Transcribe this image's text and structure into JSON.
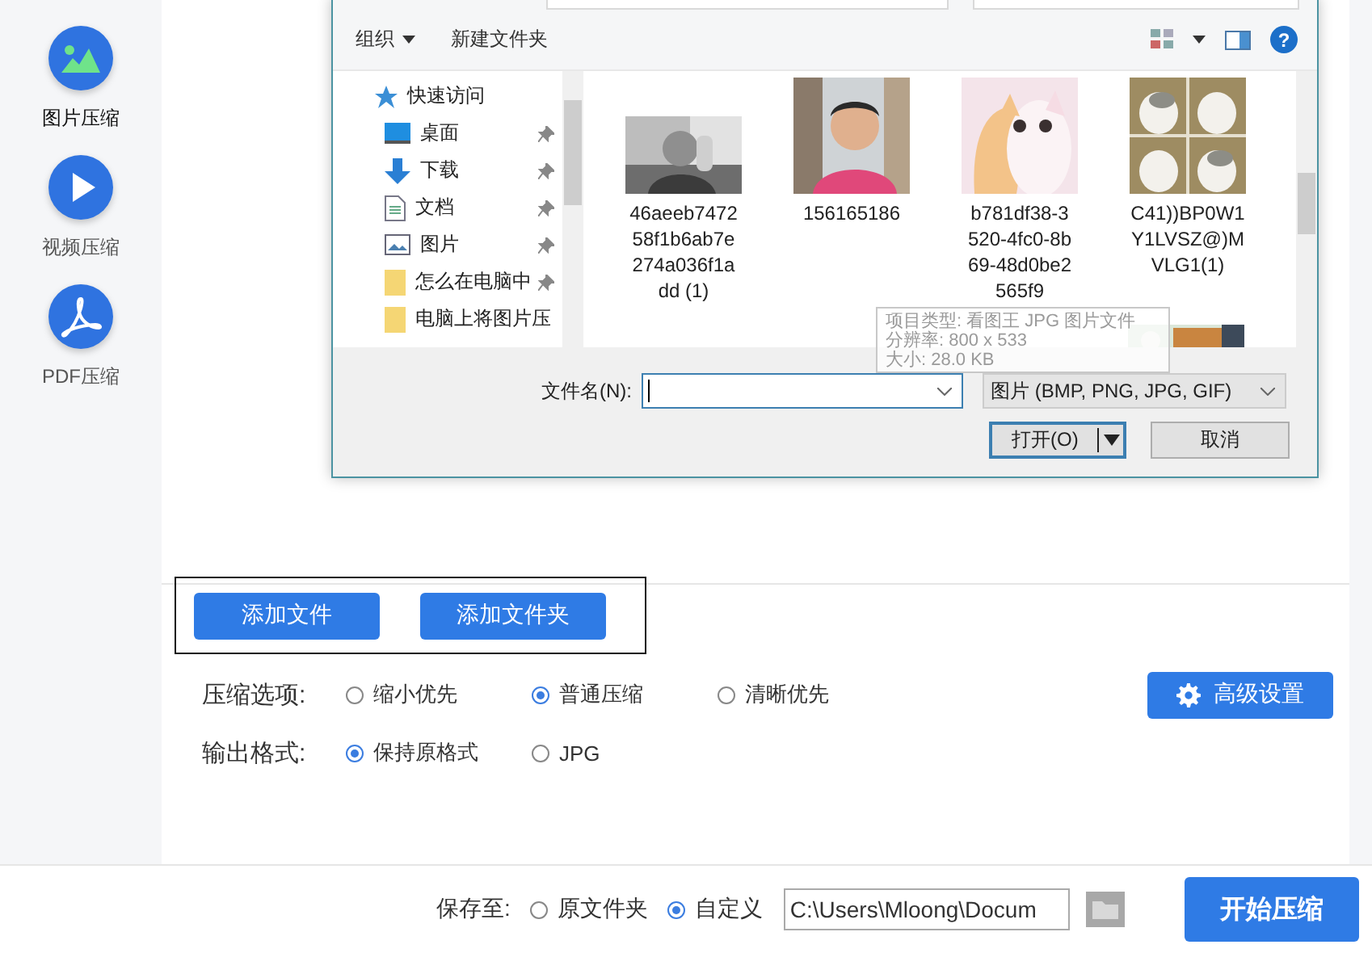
{
  "sidebar": {
    "items": [
      {
        "label": "图片压缩",
        "selected": true
      },
      {
        "label": "视频压缩",
        "selected": false
      },
      {
        "label": "PDF压缩",
        "selected": false
      }
    ]
  },
  "dialog": {
    "toolbar": {
      "organize": "组织",
      "new_folder": "新建文件夹",
      "help": "?"
    },
    "nav_items": [
      {
        "label": "快速访问",
        "pinned": false
      },
      {
        "label": "桌面",
        "pinned": true
      },
      {
        "label": "下载",
        "pinned": true
      },
      {
        "label": "文档",
        "pinned": true
      },
      {
        "label": "图片",
        "pinned": true
      },
      {
        "label": "怎么在电脑中",
        "pinned": true
      },
      {
        "label": "电脑上将图片压",
        "pinned": false
      }
    ],
    "files": [
      {
        "kind": "picture",
        "name_lines": [
          "46aeeb7472",
          "58f1b6ab7e",
          "274a036f1a",
          "dd (1)"
        ]
      },
      {
        "kind": "picture",
        "name_lines": [
          "156165186"
        ]
      },
      {
        "kind": "picture",
        "name_lines": [
          "b781df38-3",
          "520-4fc0-8b",
          "69-48d0be2",
          "565f9"
        ]
      },
      {
        "kind": "picture",
        "name_lines": [
          "C41))BP0W1",
          "Y1LVSZ@)M",
          "VLG1(1)"
        ]
      }
    ],
    "tooltip": [
      "项目类型: 看图王 JPG 图片文件",
      "分辨率: 800 x 533",
      "大小: 28.0 KB"
    ],
    "filename_label": "文件名(N):",
    "filter": "图片 (BMP, PNG, JPG, GIF)",
    "open_button": "打开(O)",
    "cancel_button": "取消"
  },
  "add_buttons": [
    "添加文件",
    "添加文件夹"
  ],
  "option_rows": [
    {
      "label": "压缩选项:",
      "choices": [
        {
          "label": "缩小优先",
          "selected": false
        },
        {
          "label": "普通压缩",
          "selected": true
        },
        {
          "label": "清晰优先",
          "selected": false
        }
      ]
    },
    {
      "label": "输出格式:",
      "choices": [
        {
          "label": "保持原格式",
          "selected": true
        },
        {
          "label": "JPG",
          "selected": false
        }
      ]
    }
  ],
  "advanced_button": "高级设置",
  "save": {
    "label": "保存至:",
    "choices": [
      {
        "label": "原文件夹",
        "selected": false
      },
      {
        "label": "自定义",
        "selected": true
      }
    ],
    "path": "C:\\Users\\Mloong\\Docum"
  },
  "start_button": "开始压缩"
}
